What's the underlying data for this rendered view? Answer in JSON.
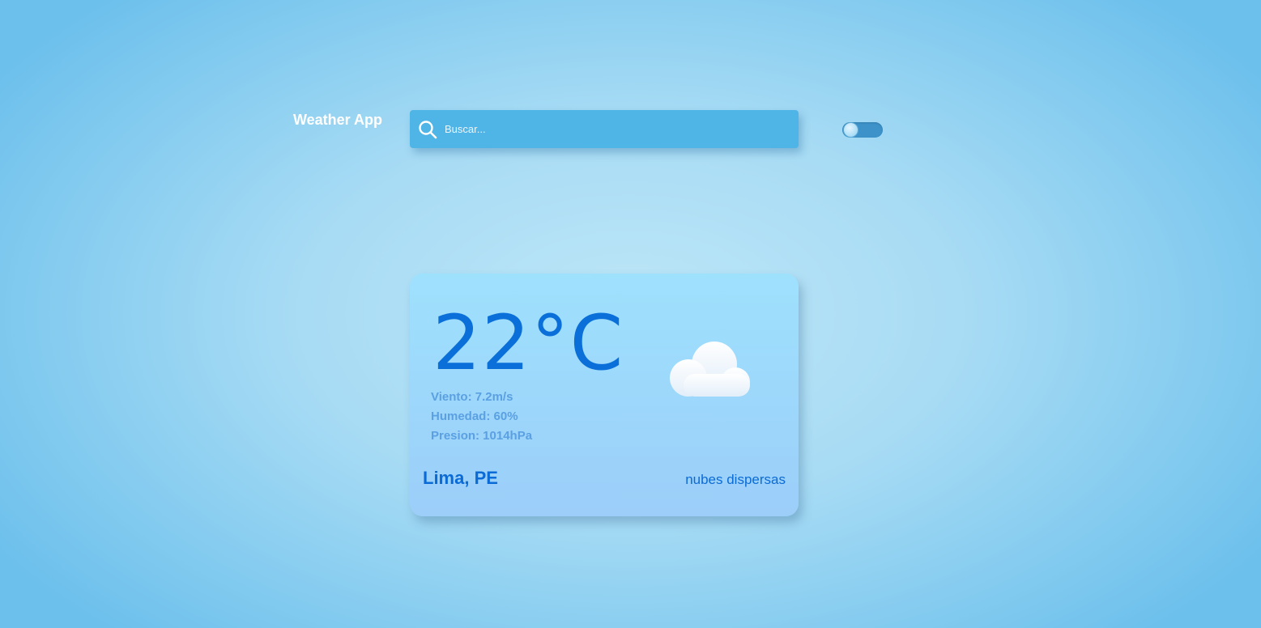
{
  "header": {
    "title": "Weather App",
    "search_placeholder": "Buscar...",
    "search_value": "",
    "toggle_state": "off"
  },
  "weather": {
    "temperature": "22°C",
    "wind": "Viento: 7.2m/s",
    "humidity": "Humedad: 60%",
    "pressure": "Presion: 1014hPa",
    "location": "Lima, PE",
    "description": "nubes dispersas",
    "icon": "cloud-icon"
  },
  "colors": {
    "accent": "#0b6bd6",
    "search_bg": "#4fb4e6",
    "detail_text": "#5aa0e2"
  }
}
